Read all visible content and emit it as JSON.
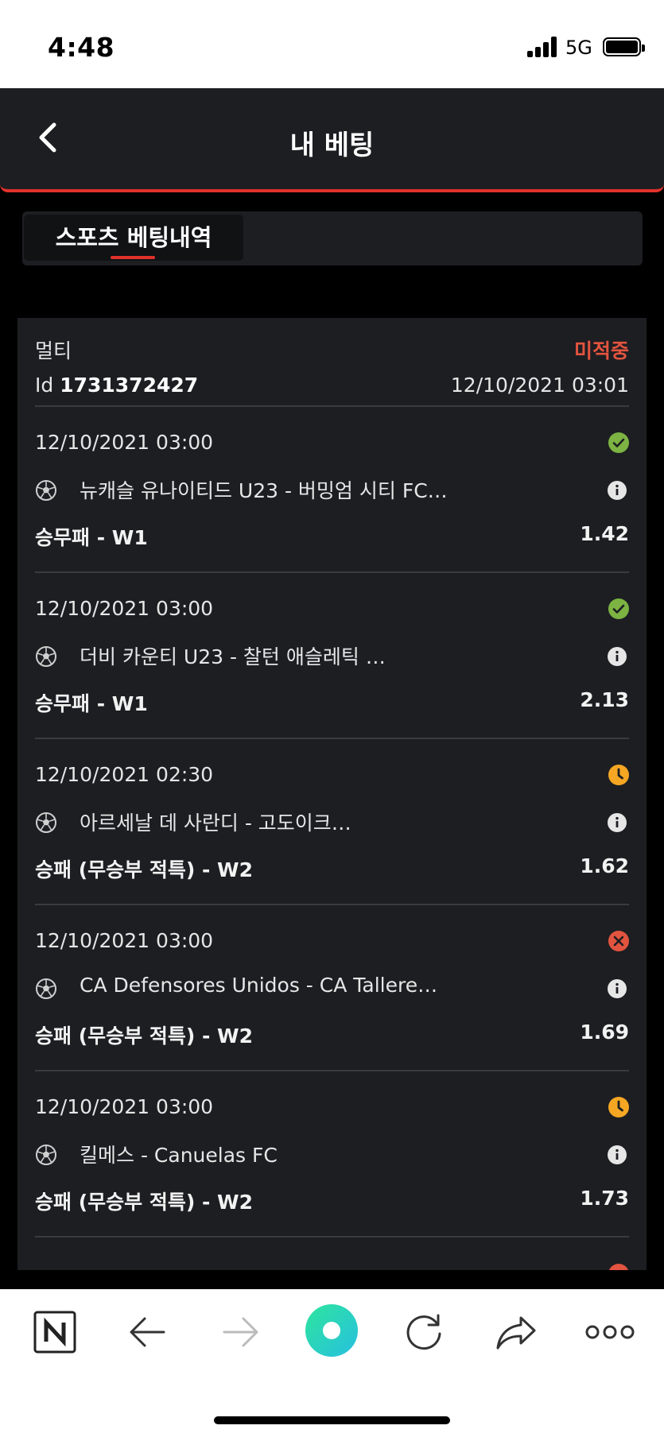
{
  "status_bar": {
    "time": "4:48",
    "network": "5G"
  },
  "header": {
    "title": "내 베팅"
  },
  "tabs": [
    {
      "label": "스포츠 베팅내역",
      "active": true
    }
  ],
  "ticket": {
    "type": "멀티",
    "status": "미적중",
    "id_label": "Id",
    "id": "1731372427",
    "date": "12/10/2021 03:01",
    "selections": [
      {
        "time": "12/10/2021 03:00",
        "status": "won",
        "match": "뉴캐슬 유나이티드 U23 - 버밍엄 시티 FC…",
        "market": "승무패 - W1",
        "odds": "1.42"
      },
      {
        "time": "12/10/2021 03:00",
        "status": "won",
        "match": "더비 카운티 U23 - 찰턴 애슬레틱 …",
        "market": "승무패 - W1",
        "odds": "2.13"
      },
      {
        "time": "12/10/2021 02:30",
        "status": "pending",
        "match": "아르세날 데 사란디 - 고도이크…",
        "market": "승패 (무승부 적특) - W2",
        "odds": "1.62"
      },
      {
        "time": "12/10/2021 03:00",
        "status": "lost",
        "match": "CA Defensores Unidos - CA Tallere…",
        "market": "승패 (무승부 적특) - W2",
        "odds": "1.69"
      },
      {
        "time": "12/10/2021 03:00",
        "status": "pending",
        "match": "킬메스 - Canuelas FC",
        "market": "승패 (무승부 적특) - W2",
        "odds": "1.73"
      }
    ]
  },
  "colors": {
    "accent": "#e0322b",
    "won": "#7cb342",
    "pending": "#f5a623",
    "lost": "#e2543f",
    "card": "#1d1e22"
  },
  "browser_bar": {
    "icons": [
      "n-home-icon",
      "back-arrow-icon",
      "forward-arrow-icon",
      "green-dot-icon",
      "refresh-icon",
      "share-icon",
      "more-icon"
    ]
  }
}
